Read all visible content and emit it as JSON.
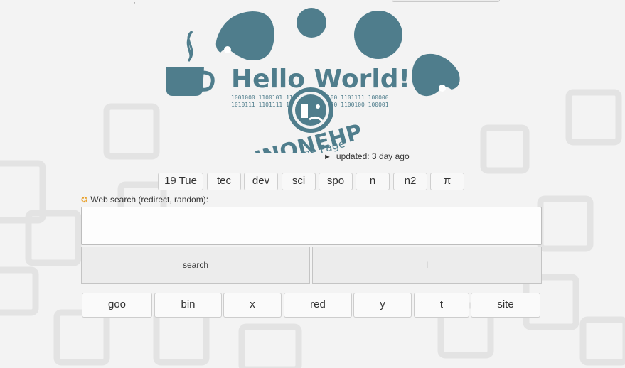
{
  "header": {
    "logo_text": "Hello World!",
    "logo_binary_1": "1001000 1100101 1101100 1101100 1101111 100000",
    "logo_binary_2": "1010111 1101111 1110010 1101100 1100100 100001",
    "logo_brand": "INONEHP",
    "logo_subtitle": "Home Page",
    "updated_arrow": "►",
    "updated_text": "updated: 3 day ago"
  },
  "tabs": [
    {
      "label": "19 Tue"
    },
    {
      "label": "tec"
    },
    {
      "label": "dev"
    },
    {
      "label": "sci"
    },
    {
      "label": "spo"
    },
    {
      "label": "n"
    },
    {
      "label": "n2"
    },
    {
      "label": "π"
    }
  ],
  "search": {
    "label": "Web search (redirect, random):",
    "value": "",
    "placeholder": "",
    "search_button": "search",
    "random_button": "I"
  },
  "engines": [
    {
      "label": "goo"
    },
    {
      "label": "bin"
    },
    {
      "label": "x"
    },
    {
      "label": "red"
    },
    {
      "label": "y"
    },
    {
      "label": "t"
    },
    {
      "label": "site"
    }
  ],
  "colors": {
    "logo_teal": "#4f7d8c",
    "star": "#e8a02a",
    "background": "#f3f3f3"
  }
}
